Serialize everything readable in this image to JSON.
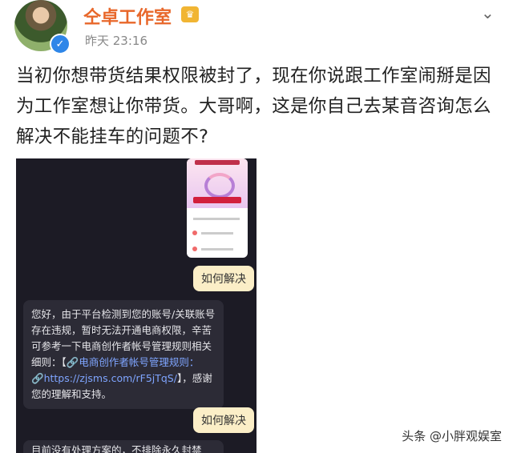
{
  "header": {
    "username": "仝卓工作室",
    "timestamp": "昨天 23:16",
    "verified_mark": "✓",
    "crown_icon": "crown-icon",
    "more_icon": "chevron-down-icon"
  },
  "post": {
    "text": "当初你想带货结果权限被封了，现在你说跟工作室闹掰是因为工作室想让你带货。大哥啊，这是你自己去某音咨询怎么解决不能挂车的问题不?"
  },
  "screenshot": {
    "user_message_1": "如何解决",
    "system_reply": {
      "text_1": "您好，由于平台检测到您的账号/关联账号存在违规，暂时无法开通电商权限，辛苦可参考一下电商创作者帐号管理规则相关细则：【",
      "link_1": "🔗电商创作者帐号管理规则：",
      "link_2": "🔗https://zjsms.com/rF5jTqS/",
      "text_2": "】，感谢您的理解和支持。"
    },
    "user_message_2": "如何解决",
    "system_reply_2": "目前没有处理方案的，不排除永久封禁"
  },
  "watermark": "头条 @小胖观娱室",
  "colors": {
    "username": "#e8672a",
    "chat_bg": "#1c1b25",
    "bubble_user": "#fbeec7",
    "bubble_system": "#2c2b36",
    "link": "#7fa5ff"
  }
}
